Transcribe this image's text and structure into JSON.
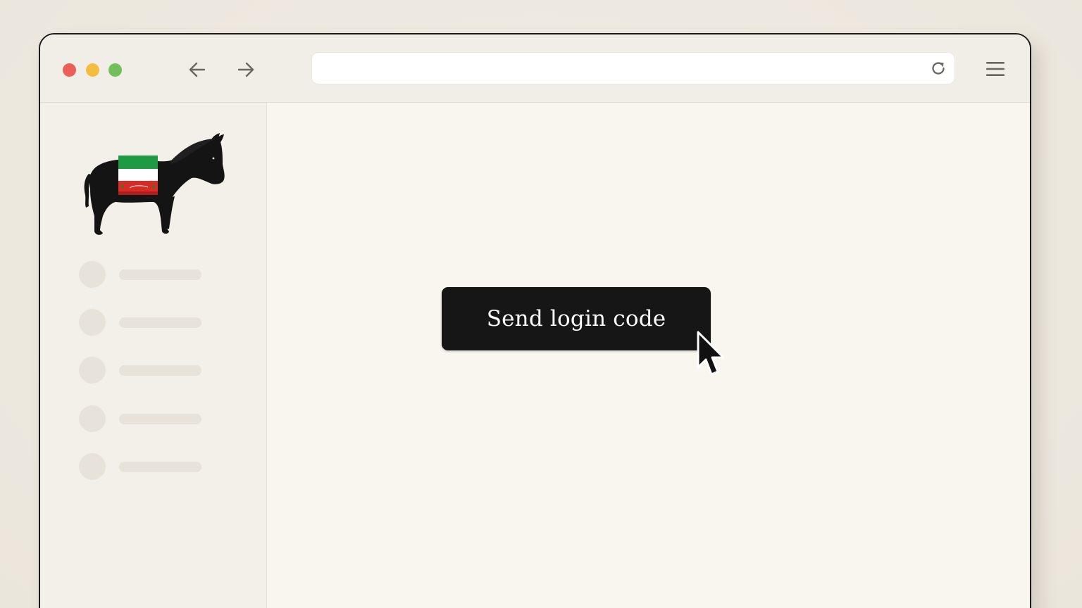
{
  "window": {
    "traffic_lights": {
      "close_color": "#ec5f57",
      "minimize_color": "#f4bd3d",
      "maximize_color": "#73bf5b"
    },
    "toolbar": {
      "back_icon": "arrow-left-icon",
      "forward_icon": "arrow-right-icon",
      "reload_icon": "reload-icon",
      "menu_icon": "hamburger-menu-icon",
      "address_value": ""
    }
  },
  "sidebar": {
    "logo": "donkey-with-flag-blanket-logo",
    "items": [
      {
        "label": "",
        "icon": "placeholder-circle"
      },
      {
        "label": "",
        "icon": "placeholder-circle"
      },
      {
        "label": "",
        "icon": "placeholder-circle"
      },
      {
        "label": "",
        "icon": "placeholder-circle"
      },
      {
        "label": "",
        "icon": "placeholder-circle"
      }
    ]
  },
  "main": {
    "primary_button": {
      "label": "Send login code",
      "background": "#161616",
      "text_color": "#ffffff"
    },
    "cursor_icon": "mouse-pointer-icon"
  }
}
